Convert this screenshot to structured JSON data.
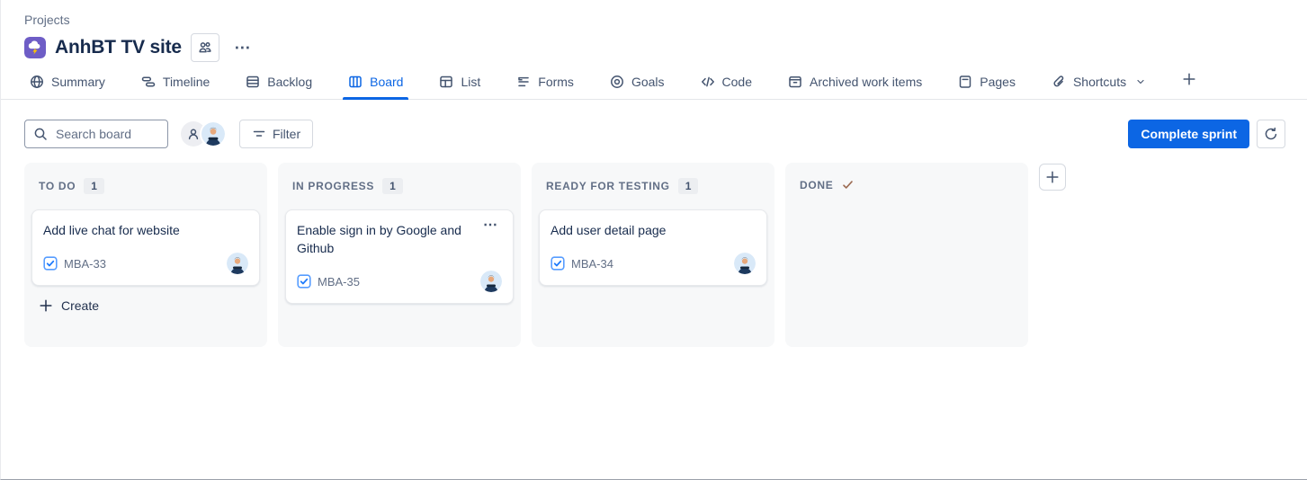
{
  "breadcrumb": {
    "label": "Projects"
  },
  "project": {
    "title": "AnhBT TV site",
    "icon": "storm-project-icon"
  },
  "header_actions": {
    "people_icon": "people-group-icon",
    "more_icon": "more-horizontal-icon"
  },
  "tabs": [
    {
      "label": "Summary",
      "icon": "globe-icon"
    },
    {
      "label": "Timeline",
      "icon": "timeline-icon"
    },
    {
      "label": "Backlog",
      "icon": "backlog-icon"
    },
    {
      "label": "Board",
      "icon": "board-icon",
      "active": true
    },
    {
      "label": "List",
      "icon": "list-icon"
    },
    {
      "label": "Forms",
      "icon": "forms-icon"
    },
    {
      "label": "Goals",
      "icon": "goals-icon"
    },
    {
      "label": "Code",
      "icon": "code-icon"
    },
    {
      "label": "Archived work items",
      "icon": "archive-icon"
    },
    {
      "label": "Pages",
      "icon": "pages-icon"
    },
    {
      "label": "Shortcuts",
      "icon": "shortcut-icon",
      "chevron": true
    }
  ],
  "toolbar": {
    "search_placeholder": "Search board",
    "search_icon": "search-icon",
    "avatars": [
      {
        "icon": "person-icon"
      },
      {
        "icon": "user-photo-avatar"
      }
    ],
    "filter_label": "Filter",
    "filter_icon": "filter-icon",
    "complete_sprint_label": "Complete sprint",
    "sprint_icon": "sprint-icon"
  },
  "board": {
    "create_label": "Create",
    "columns": [
      {
        "name": "TO DO",
        "count": "1",
        "show_create": true,
        "cards": [
          {
            "title": "Add live chat for website",
            "key": "MBA-33",
            "type_icon": "task-icon",
            "avatar": "user-photo-avatar"
          }
        ]
      },
      {
        "name": "IN PROGRESS",
        "count": "1",
        "cards": [
          {
            "title": "Enable sign in by Google and Github",
            "key": "MBA-35",
            "type_icon": "task-icon",
            "avatar": "user-photo-avatar",
            "has_menu": true
          }
        ]
      },
      {
        "name": "READY FOR TESTING",
        "count": "1",
        "cards": [
          {
            "title": "Add user detail page",
            "key": "MBA-34",
            "type_icon": "task-icon",
            "avatar": "user-photo-avatar"
          }
        ]
      },
      {
        "name": "DONE",
        "done_check": true,
        "cards": []
      }
    ]
  },
  "colors": {
    "accent_blue": "#0C66E4",
    "task_checkbox_blue": "#388BFF",
    "done_check_brown": "#9C6B52",
    "title_text": "#172B4D",
    "muted_text": "#626F86",
    "column_bg": "#F7F8F9"
  }
}
